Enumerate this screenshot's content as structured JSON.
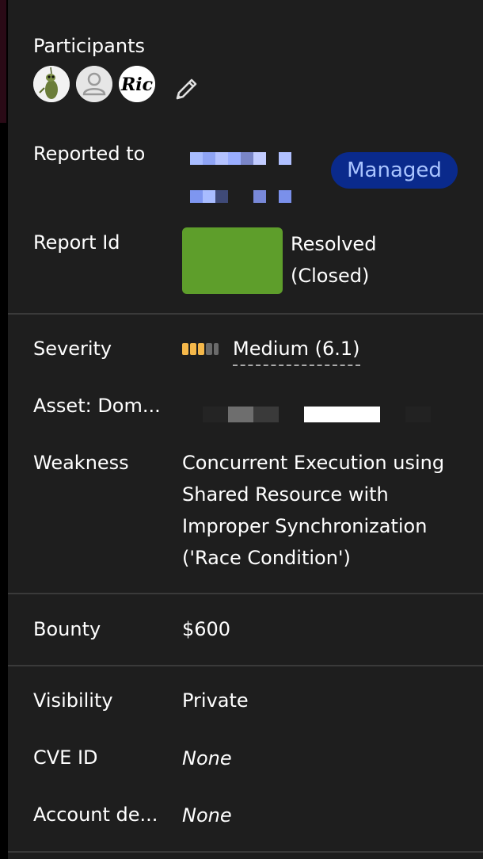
{
  "participants": {
    "label": "Participants",
    "avatars": [
      {
        "name": "avatar-1"
      },
      {
        "name": "avatar-2"
      },
      {
        "name": "avatar-3",
        "text": "Ric"
      }
    ],
    "edit_icon": "pencil-icon"
  },
  "reported_to": {
    "label": "Reported to",
    "badge": "Managed"
  },
  "report_id": {
    "label": "Report Id",
    "status_line1": "Resolved",
    "status_line2": "(Closed)"
  },
  "severity": {
    "label": "Severity",
    "value": "Medium (6.1)",
    "level": 3,
    "max_level": 5
  },
  "asset": {
    "label": "Asset: Dom..."
  },
  "weakness": {
    "label": "Weakness",
    "value": "Concurrent Execution using Shared Resource with Improper Synchronization ('Race Condition')"
  },
  "bounty": {
    "label": "Bounty",
    "value": "$600"
  },
  "visibility": {
    "label": "Visibility",
    "value": "Private"
  },
  "cve": {
    "label": "CVE ID",
    "value": "None"
  },
  "account": {
    "label": "Account de...",
    "value": "None"
  },
  "colors": {
    "panel_bg": "#1e1e1e",
    "badge_bg": "#0a2a8c",
    "badge_text": "#a9c4ff",
    "report_id_box": "#5e9e2b",
    "severity_active": "#f5b84a",
    "severity_inactive": "#6a6a6a"
  }
}
